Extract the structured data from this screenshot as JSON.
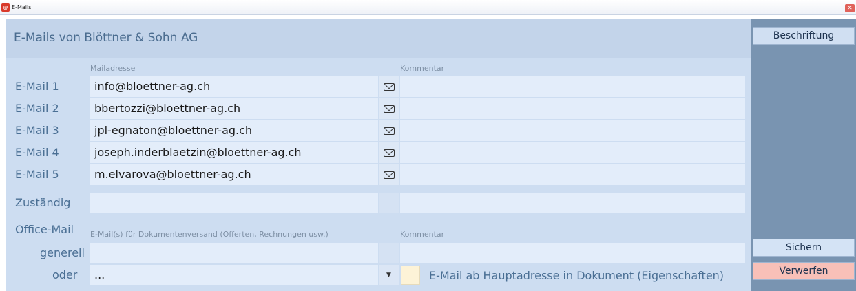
{
  "window": {
    "title": "E-Mails",
    "app_icon": "app-logo-icon",
    "close_label": "✕"
  },
  "header": {
    "title": "E-Mails von Blöttner & Sohn AG"
  },
  "columns": {
    "mail": "Mailadresse",
    "comment": "Kommentar"
  },
  "emails": [
    {
      "label": "E-Mail 1",
      "address": "info@bloettner-ag.ch",
      "comment": ""
    },
    {
      "label": "E-Mail 2",
      "address": "bbertozzi@bloettner-ag.ch",
      "comment": ""
    },
    {
      "label": "E-Mail 3",
      "address": "jpl-egnaton@bloettner-ag.ch",
      "comment": ""
    },
    {
      "label": "E-Mail 4",
      "address": "joseph.inderblaetzin@bloettner-ag.ch",
      "comment": ""
    },
    {
      "label": "E-Mail 5",
      "address": "m.elvarova@bloettner-ag.ch",
      "comment": ""
    }
  ],
  "zustaendig": {
    "label": "Zuständig",
    "value": "",
    "comment": ""
  },
  "office": {
    "label": "Office-Mail",
    "mail_header": "E-Mail(s) für Dokumentenversand (Offerten, Rechnungen usw.)",
    "comment_header": "Kommentar",
    "generell_label": "generell",
    "generell_value": "",
    "oder_label": "oder",
    "oder_value": "...",
    "dropdown_glyph": "▼",
    "checkbox_checked": false,
    "checkbox_label": "E-Mail ab Hauptadresse in Dokument (Eigenschaften)"
  },
  "sidebar": {
    "beschriftung": "Beschriftung",
    "sichern": "Sichern",
    "verwerfen": "Verwerfen"
  },
  "colors": {
    "main_bg": "#cdddf1",
    "sidebar_bg": "#7994b1",
    "field_bg": "#e3edfa",
    "label": "#4a6f94",
    "verwerfen_bg": "#f8c0b8"
  }
}
